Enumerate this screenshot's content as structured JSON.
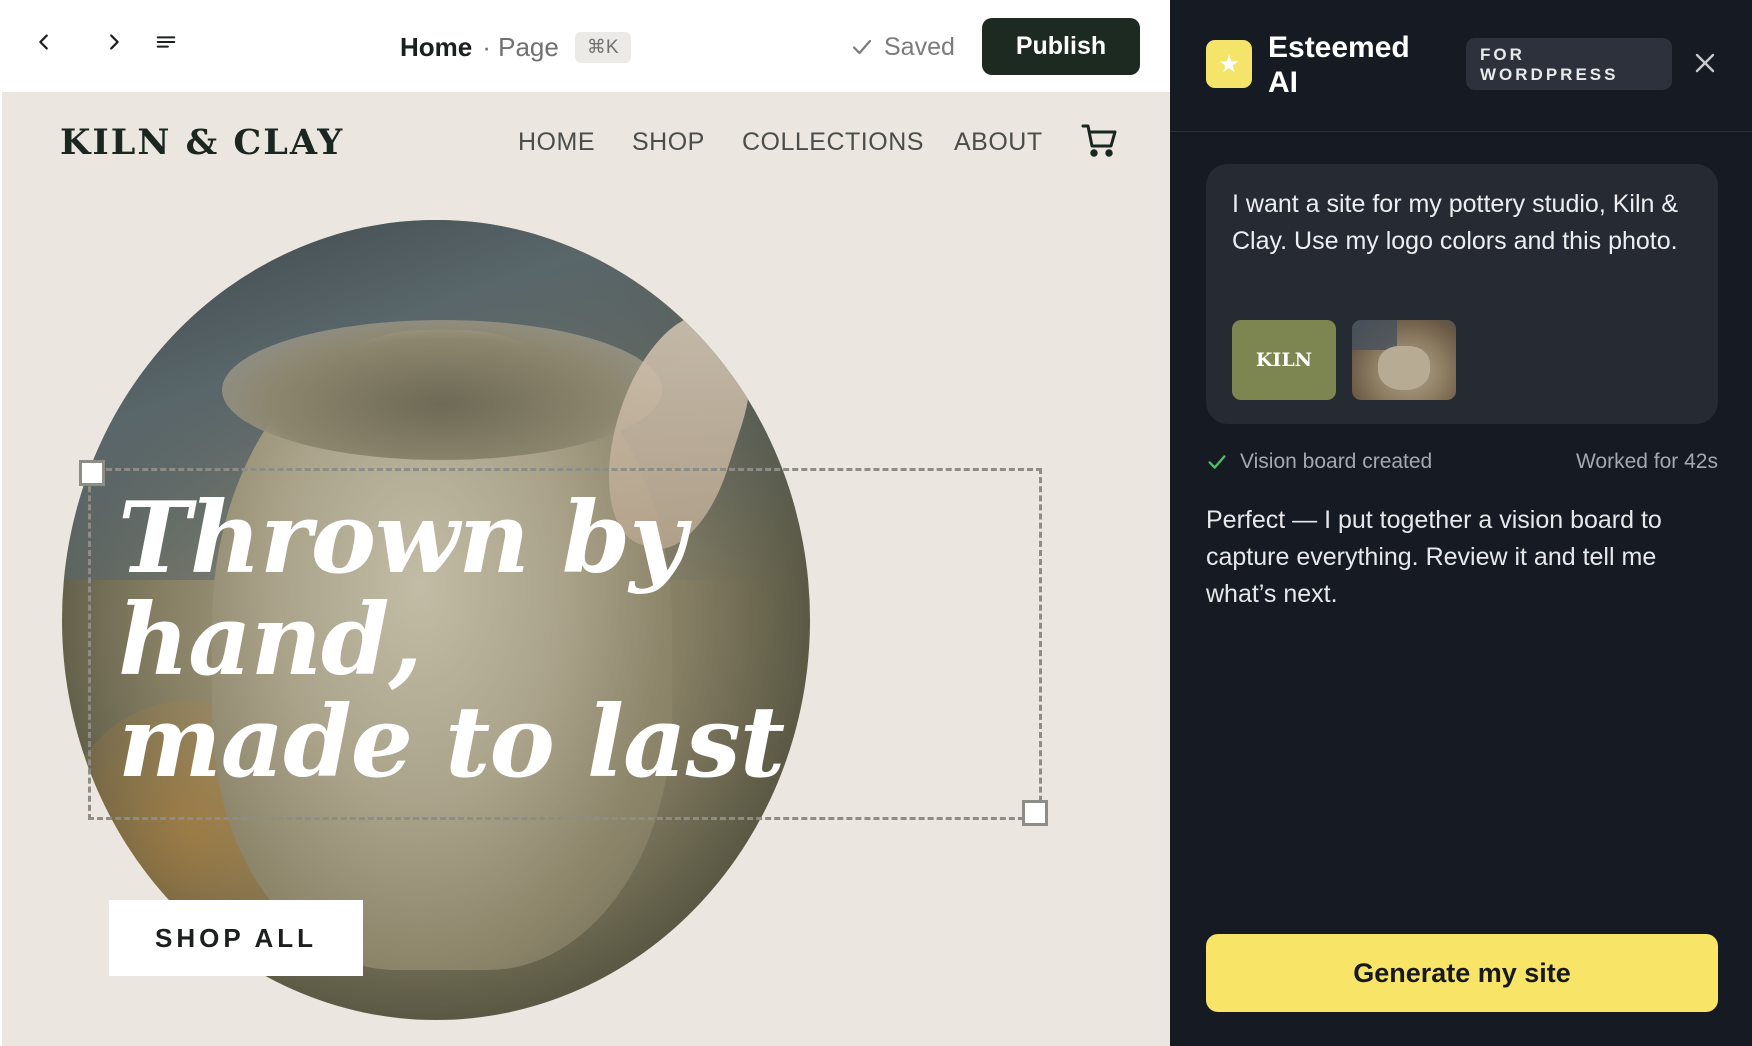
{
  "topbar": {
    "back_icon": "chevron-left-icon",
    "forward_icon": "chevron-right-icon",
    "menu_icon": "menu-icon",
    "doc_title": "Home",
    "doc_type": "· Page",
    "shortcut": "⌘K",
    "saved_label": "Saved",
    "publish_label": "Publish"
  },
  "site": {
    "logo_text": "KILN & CLAY",
    "nav": [
      "HOME",
      "SHOP",
      "COLLECTIONS",
      "ABOUT"
    ],
    "hero_title": "Thrown by\nhand,\nmade to last",
    "cta_label": "SHOP ALL"
  },
  "panel": {
    "title": "Esteemed AI",
    "badge": "FOR WORDPRESS",
    "user_message": "I want a site for my pottery studio, Kiln & Clay. Use my logo colors and this photo.",
    "attachment_logo_text": "KILN",
    "status_label": "Vision board created",
    "worked_for": "Worked for 42s",
    "reply": "Perfect — I put together a vision board to capture everything. Review it and tell me what’s next.",
    "generate_label": "Generate my site"
  },
  "colors": {
    "publish_bg": "#1c2a22",
    "panel_bg": "#161a22",
    "accent_yellow": "#f8e466",
    "logo_green": "#7d8650",
    "canvas_bg": "#ebe6df",
    "success_green": "#4fc06a"
  }
}
